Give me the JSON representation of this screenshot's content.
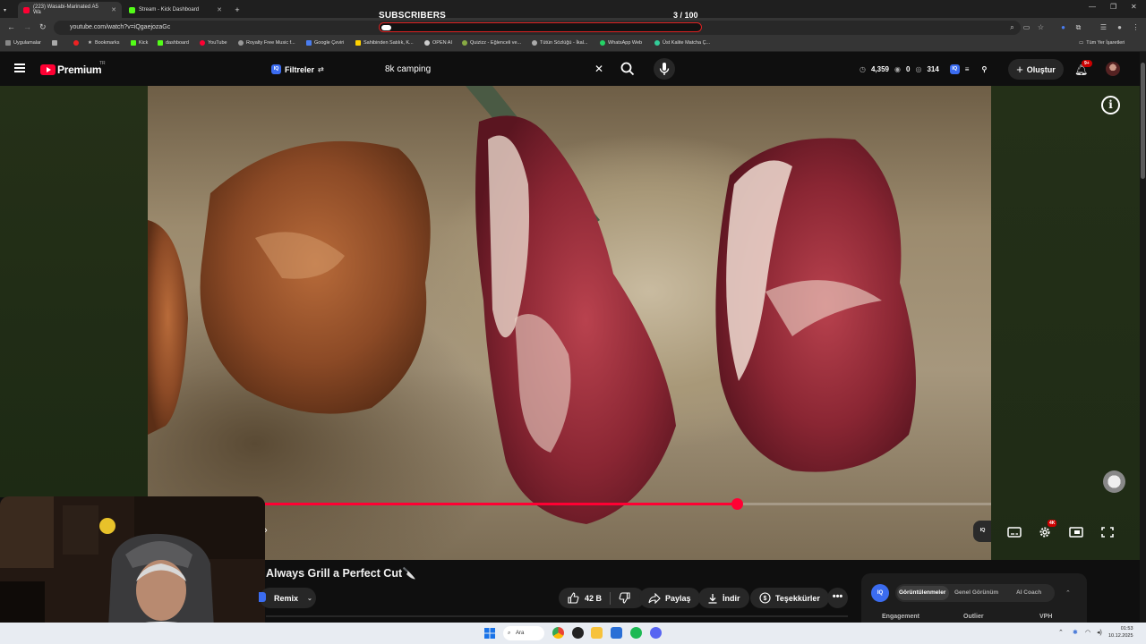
{
  "browser": {
    "tabs": [
      {
        "title": "(223) Wasabi-Marinated A5 Wa",
        "active": true
      },
      {
        "title": "Stream - Kick Dashboard",
        "active": false
      }
    ],
    "new_tab": "+",
    "url": "youtube.com/watch?v=iQgaejozaGc",
    "bookmarks_label_apps": "Uygulamalar",
    "bookmarks": [
      "Bookmarks",
      "Kick",
      "dashboard",
      "YouTube",
      "Royalty Free Music f...",
      "Google Çeviri",
      "Sahibinden Satılık, K...",
      "OPEN AI",
      "Quizizz - Eğlenceli ve...",
      "Tütün Sözlüğü - İkal...",
      "WhatsApp Web",
      "Üst Kalite Matcha Ç..."
    ],
    "all_bookmarks": "Tüm Yer İşaretleri"
  },
  "subscribers_widget": {
    "label": "SUBSCRIBERS",
    "count": "3  / 100",
    "progress_fraction": 0.03
  },
  "youtube": {
    "logo_text": "Premium",
    "logo_region": "TR",
    "filters_label": "Filtreler",
    "search_value": "8k camping",
    "stats": {
      "watch": "4,359",
      "eye": "0",
      "views": "314"
    },
    "create_label": "Oluştur",
    "notification_badge": "9+"
  },
  "player": {
    "progress_fraction": 0.65,
    "quality_badge": "4K"
  },
  "video": {
    "title": "Always Grill a Perfect Cut🔪",
    "remix_label": "Remix",
    "likes": "42 B",
    "share_label": "Paylaş",
    "download_label": "İndir",
    "thanks_label": "Teşekkürler",
    "more": "•••"
  },
  "iq_panel": {
    "logo": "IQ",
    "tabs": [
      "Görüntülenmeler",
      "Genel Görünüm",
      "AI Coach"
    ],
    "columns": [
      "Engagement",
      "Outlier",
      "VPH"
    ]
  },
  "taskbar": {
    "search_label": "Ara",
    "time": "01:53",
    "date": "10.12.2025"
  }
}
